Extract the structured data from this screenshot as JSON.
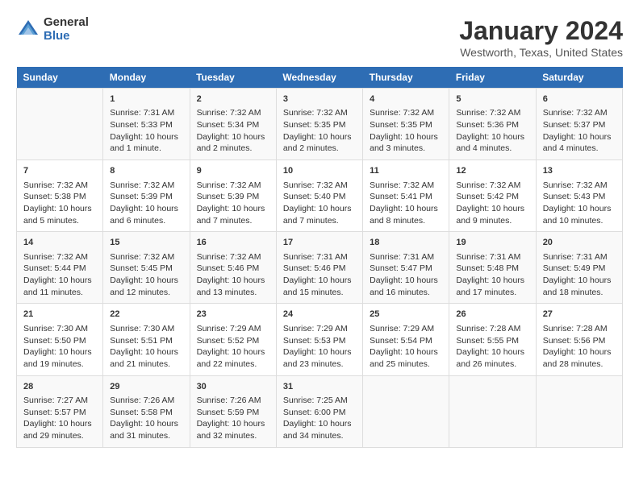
{
  "header": {
    "logo": {
      "general": "General",
      "blue": "Blue"
    },
    "title": "January 2024",
    "subtitle": "Westworth, Texas, United States"
  },
  "days_header": [
    "Sunday",
    "Monday",
    "Tuesday",
    "Wednesday",
    "Thursday",
    "Friday",
    "Saturday"
  ],
  "weeks": [
    [
      {
        "day": "",
        "content": ""
      },
      {
        "day": "1",
        "content": "Sunrise: 7:31 AM\nSunset: 5:33 PM\nDaylight: 10 hours\nand 1 minute."
      },
      {
        "day": "2",
        "content": "Sunrise: 7:32 AM\nSunset: 5:34 PM\nDaylight: 10 hours\nand 2 minutes."
      },
      {
        "day": "3",
        "content": "Sunrise: 7:32 AM\nSunset: 5:35 PM\nDaylight: 10 hours\nand 2 minutes."
      },
      {
        "day": "4",
        "content": "Sunrise: 7:32 AM\nSunset: 5:35 PM\nDaylight: 10 hours\nand 3 minutes."
      },
      {
        "day": "5",
        "content": "Sunrise: 7:32 AM\nSunset: 5:36 PM\nDaylight: 10 hours\nand 4 minutes."
      },
      {
        "day": "6",
        "content": "Sunrise: 7:32 AM\nSunset: 5:37 PM\nDaylight: 10 hours\nand 4 minutes."
      }
    ],
    [
      {
        "day": "7",
        "content": "Sunrise: 7:32 AM\nSunset: 5:38 PM\nDaylight: 10 hours\nand 5 minutes."
      },
      {
        "day": "8",
        "content": "Sunrise: 7:32 AM\nSunset: 5:39 PM\nDaylight: 10 hours\nand 6 minutes."
      },
      {
        "day": "9",
        "content": "Sunrise: 7:32 AM\nSunset: 5:39 PM\nDaylight: 10 hours\nand 7 minutes."
      },
      {
        "day": "10",
        "content": "Sunrise: 7:32 AM\nSunset: 5:40 PM\nDaylight: 10 hours\nand 7 minutes."
      },
      {
        "day": "11",
        "content": "Sunrise: 7:32 AM\nSunset: 5:41 PM\nDaylight: 10 hours\nand 8 minutes."
      },
      {
        "day": "12",
        "content": "Sunrise: 7:32 AM\nSunset: 5:42 PM\nDaylight: 10 hours\nand 9 minutes."
      },
      {
        "day": "13",
        "content": "Sunrise: 7:32 AM\nSunset: 5:43 PM\nDaylight: 10 hours\nand 10 minutes."
      }
    ],
    [
      {
        "day": "14",
        "content": "Sunrise: 7:32 AM\nSunset: 5:44 PM\nDaylight: 10 hours\nand 11 minutes."
      },
      {
        "day": "15",
        "content": "Sunrise: 7:32 AM\nSunset: 5:45 PM\nDaylight: 10 hours\nand 12 minutes."
      },
      {
        "day": "16",
        "content": "Sunrise: 7:32 AM\nSunset: 5:46 PM\nDaylight: 10 hours\nand 13 minutes."
      },
      {
        "day": "17",
        "content": "Sunrise: 7:31 AM\nSunset: 5:46 PM\nDaylight: 10 hours\nand 15 minutes."
      },
      {
        "day": "18",
        "content": "Sunrise: 7:31 AM\nSunset: 5:47 PM\nDaylight: 10 hours\nand 16 minutes."
      },
      {
        "day": "19",
        "content": "Sunrise: 7:31 AM\nSunset: 5:48 PM\nDaylight: 10 hours\nand 17 minutes."
      },
      {
        "day": "20",
        "content": "Sunrise: 7:31 AM\nSunset: 5:49 PM\nDaylight: 10 hours\nand 18 minutes."
      }
    ],
    [
      {
        "day": "21",
        "content": "Sunrise: 7:30 AM\nSunset: 5:50 PM\nDaylight: 10 hours\nand 19 minutes."
      },
      {
        "day": "22",
        "content": "Sunrise: 7:30 AM\nSunset: 5:51 PM\nDaylight: 10 hours\nand 21 minutes."
      },
      {
        "day": "23",
        "content": "Sunrise: 7:29 AM\nSunset: 5:52 PM\nDaylight: 10 hours\nand 22 minutes."
      },
      {
        "day": "24",
        "content": "Sunrise: 7:29 AM\nSunset: 5:53 PM\nDaylight: 10 hours\nand 23 minutes."
      },
      {
        "day": "25",
        "content": "Sunrise: 7:29 AM\nSunset: 5:54 PM\nDaylight: 10 hours\nand 25 minutes."
      },
      {
        "day": "26",
        "content": "Sunrise: 7:28 AM\nSunset: 5:55 PM\nDaylight: 10 hours\nand 26 minutes."
      },
      {
        "day": "27",
        "content": "Sunrise: 7:28 AM\nSunset: 5:56 PM\nDaylight: 10 hours\nand 28 minutes."
      }
    ],
    [
      {
        "day": "28",
        "content": "Sunrise: 7:27 AM\nSunset: 5:57 PM\nDaylight: 10 hours\nand 29 minutes."
      },
      {
        "day": "29",
        "content": "Sunrise: 7:26 AM\nSunset: 5:58 PM\nDaylight: 10 hours\nand 31 minutes."
      },
      {
        "day": "30",
        "content": "Sunrise: 7:26 AM\nSunset: 5:59 PM\nDaylight: 10 hours\nand 32 minutes."
      },
      {
        "day": "31",
        "content": "Sunrise: 7:25 AM\nSunset: 6:00 PM\nDaylight: 10 hours\nand 34 minutes."
      },
      {
        "day": "",
        "content": ""
      },
      {
        "day": "",
        "content": ""
      },
      {
        "day": "",
        "content": ""
      }
    ]
  ]
}
